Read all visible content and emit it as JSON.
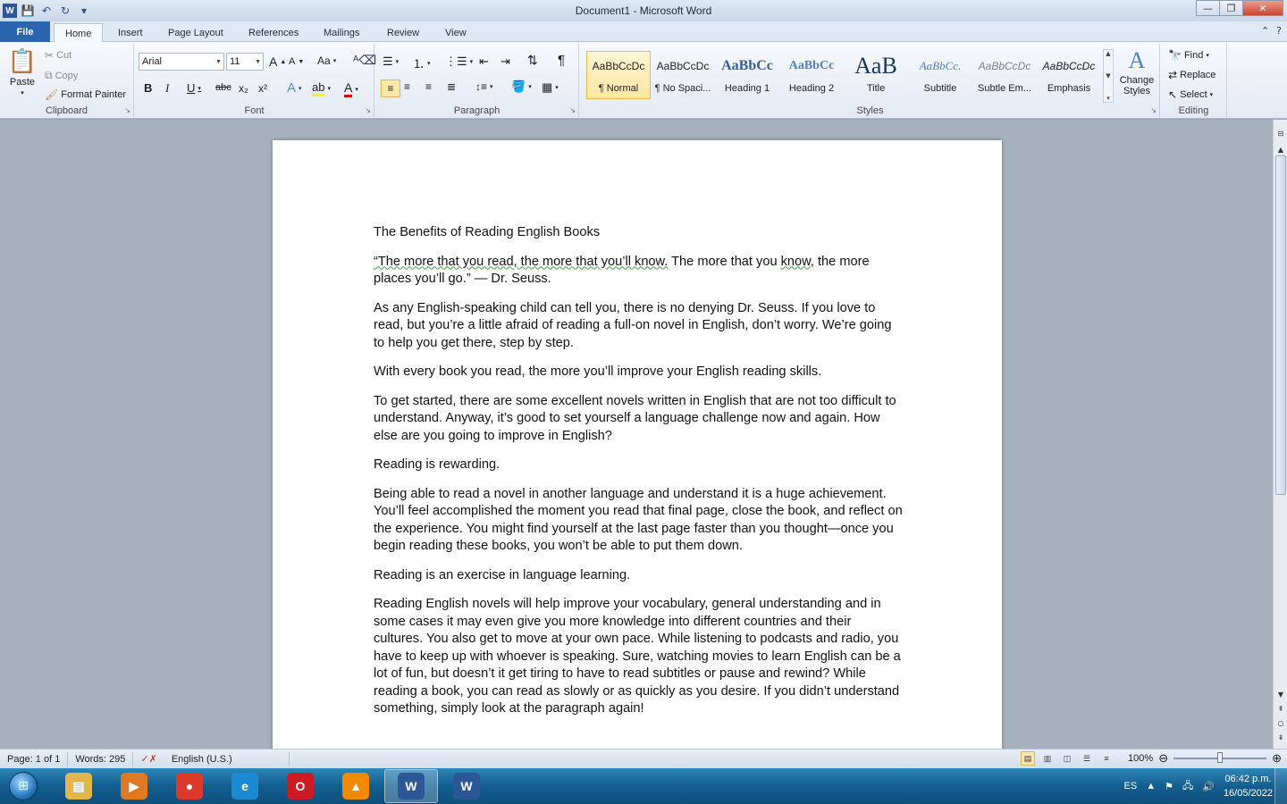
{
  "window": {
    "title": "Document1 - Microsoft Word",
    "app_icon": "W",
    "controls": {
      "minimize": "—",
      "maximize": "❐",
      "close": "✕"
    }
  },
  "ribbon_tabs": [
    "File",
    "Home",
    "Insert",
    "Page Layout",
    "References",
    "Mailings",
    "Review",
    "View"
  ],
  "clipboard": {
    "paste": "Paste",
    "cut": "Cut",
    "copy": "Copy",
    "format_painter": "Format Painter",
    "label": "Clipboard"
  },
  "font": {
    "name": "Arial",
    "size": "11",
    "label": "Font",
    "bold": "B",
    "italic": "I",
    "underline": "U",
    "strike": "abc",
    "sub": "x₂",
    "sup": "x²",
    "case": "Aa",
    "grow": "A",
    "shrink": "A"
  },
  "paragraph": {
    "label": "Paragraph",
    "pilcrow": "¶"
  },
  "styles": {
    "label": "Styles",
    "items": [
      {
        "preview": "AaBbCcDc",
        "name": "¶ Normal"
      },
      {
        "preview": "AaBbCcDc",
        "name": "¶ No Spaci..."
      },
      {
        "preview": "AaBbCc",
        "name": "Heading 1"
      },
      {
        "preview": "AaBbCc",
        "name": "Heading 2"
      },
      {
        "preview": "AaB",
        "name": "Title"
      },
      {
        "preview": "AaBbCc.",
        "name": "Subtitle"
      },
      {
        "preview": "AaBbCcDc",
        "name": "Subtle Em..."
      },
      {
        "preview": "AaBbCcDc",
        "name": "Emphasis"
      }
    ],
    "change_styles": "Change Styles"
  },
  "editing": {
    "label": "Editing",
    "find": "Find",
    "replace": "Replace",
    "select": "Select"
  },
  "document": {
    "title": "The Benefits of Reading English Books",
    "quote_a": "“The more that you read, the more that you’ll know.",
    "quote_b": " The more that you ",
    "quote_c": "know,",
    "quote_d": " the more places you’ll go.” — Dr. Seuss.",
    "p1": "As any English-speaking child can tell you, there is no denying Dr. Seuss. If you love to read, but you’re a little afraid of reading a full-on novel in English, don’t worry. We’re going to help you get there, step by step.",
    "p2": "With every book you read, the more you’ll improve your English reading skills.",
    "p3": "To get started, there are some excellent novels written in English that are not too difficult to understand. Anyway, it’s good to set yourself a language challenge now and again. How else are you going to improve in English?",
    "p4": "Reading is rewarding.",
    "p5": "Being able to read a novel in another language and understand it is a huge achievement. You’ll feel accomplished the moment you read that final page, close the book, and reflect on the experience. You might find yourself at the last page faster than you thought—once you begin reading these books, you won’t be able to put them down.",
    "p6": "Reading is an exercise in language learning.",
    "p7": "Reading English novels will help improve your vocabulary, general understanding and in some cases it may even give you more knowledge into different countries and their cultures. You also get to move at your own pace. While listening to podcasts and radio, you have to keep up with whoever is speaking. Sure, watching movies to learn English can be a lot of fun, but doesn’t it get tiring to have to read subtitles or pause and rewind? While reading a book, you can read as slowly or as quickly as you desire. If you didn’t understand something, simply look at the paragraph again!"
  },
  "status": {
    "page": "Page: 1 of 1",
    "words": "Words: 295",
    "language": "English (U.S.)",
    "zoom": "100%",
    "zoom_fraction": 0.5
  },
  "tray": {
    "lang": "ES",
    "time": "06:42 p.m.",
    "date": "16/05/2022"
  },
  "taskbar_apps": [
    {
      "name": "file-explorer",
      "glyph": "▤",
      "color": "#e3b54a"
    },
    {
      "name": "media-player",
      "glyph": "▶",
      "color": "#e07a22"
    },
    {
      "name": "chrome",
      "glyph": "●",
      "color": "#db3a2b"
    },
    {
      "name": "edge",
      "glyph": "e",
      "color": "#1b8ad1"
    },
    {
      "name": "opera",
      "glyph": "O",
      "color": "#cc1b24"
    },
    {
      "name": "vlc",
      "glyph": "▲",
      "color": "#f08a00"
    },
    {
      "name": "word-1",
      "glyph": "W",
      "color": "#2b5797"
    },
    {
      "name": "word-2",
      "glyph": "W",
      "color": "#2b5797"
    }
  ]
}
